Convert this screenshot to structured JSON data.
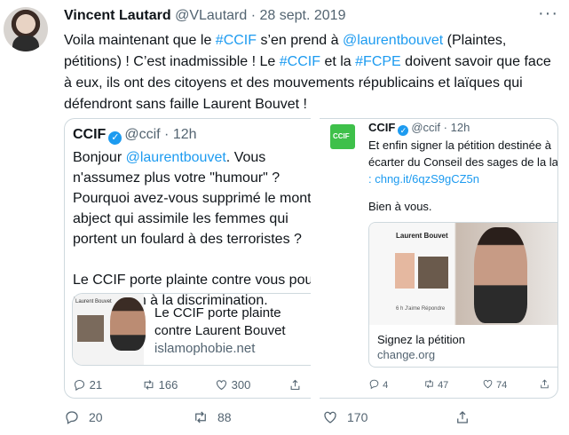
{
  "tweet": {
    "author_name": "Vincent Lautard",
    "handle": "@VLautard",
    "separator": "·",
    "date": "28 sept. 2019",
    "more_icon": "more-icon",
    "text": [
      {
        "t": "Voila maintenant que le ",
        "k": "p"
      },
      {
        "t": "#CCIF",
        "k": "h"
      },
      {
        "t": " s’en prend à ",
        "k": "p"
      },
      {
        "t": "@laurentbouvet",
        "k": "h"
      },
      {
        "t": " (Plaintes, pétitions) ! C’est inadmissible ! Le ",
        "k": "p"
      },
      {
        "t": "#CCIF",
        "k": "h"
      },
      {
        "t": " et la ",
        "k": "p"
      },
      {
        "t": "#FCPE",
        "k": "h"
      },
      {
        "t": " doivent savoir que face à eux, ils ont des citoyens et des mouvements républicains et laïques qui défendront sans faille Laurent Bouvet !",
        "k": "p"
      }
    ],
    "actions": {
      "reply": "20",
      "retweet": "88",
      "like": "170"
    }
  },
  "quote_left": {
    "name": "CCIF",
    "handle": "@ccif",
    "separator": "·",
    "time": "12h",
    "lines": [
      {
        "pre": "Bonjour ",
        "mention": "@laurentbouvet",
        "post": ". Vous"
      },
      {
        "pre": "n'assumez plus votre \"humour\" ?",
        "mention": "",
        "post": ""
      },
      {
        "pre": "Pourquoi avez-vous supprimé le mont",
        "mention": "",
        "post": ""
      },
      {
        "pre": "abject qui assimile les femmes qui",
        "mention": "",
        "post": ""
      },
      {
        "pre": "portent un foulard à des terroristes ?",
        "mention": "",
        "post": ""
      },
      {
        "pre": "",
        "mention": "",
        "post": ""
      },
      {
        "pre": "Le CCIF porte plainte contre vous pou",
        "mention": "",
        "post": ""
      },
      {
        "pre": "provocation à la discrimination.",
        "mention": "",
        "post": ""
      }
    ],
    "link_card": {
      "thumb_label": "Laurent Bouvet",
      "title": "Le CCIF porte plainte contre Laurent Bouvet",
      "domain": "islamophobie.net"
    },
    "actions": {
      "reply": "21",
      "retweet": "166",
      "like": "300"
    }
  },
  "quote_right": {
    "name": "CCIF",
    "handle": "@ccif",
    "separator": "·",
    "time": "12h",
    "lines": [
      "Et enfin signer la pétition destinée à",
      "écarter du Conseil des sages de la la"
    ],
    "link": ": chng.it/6qzS9gCZ5n",
    "greeting": "Bien à vous.",
    "link_card": {
      "image_name": "Laurent Bouvet",
      "image_footer": "6 h   J'aime   Répondre",
      "title": "Signez la pétition",
      "domain": "change.org"
    },
    "actions": {
      "reply": "4",
      "retweet": "47",
      "like": "74"
    }
  },
  "colors": {
    "accent": "#1d9bf0",
    "muted": "#536471",
    "border": "#cfd9de"
  }
}
